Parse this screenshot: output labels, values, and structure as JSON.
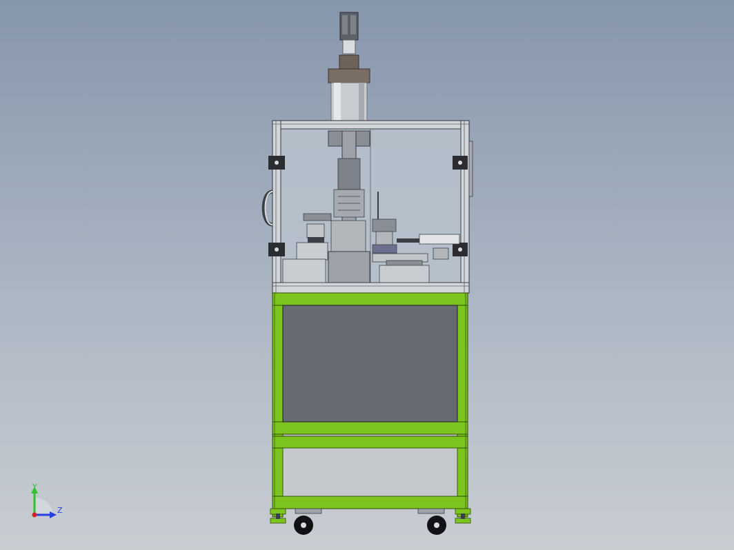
{
  "viewport": {
    "background_top": "#8696ab",
    "background_bottom": "#c9cdd2"
  },
  "model": {
    "frame_color": "#7cc41e",
    "frame_edge_color": "#2f4a0c",
    "panel_color": "#666a71",
    "glass_color": "#b9c2cc",
    "aluminum_color": "#d2d5d9"
  },
  "triad": {
    "y_label": "Y",
    "z_label": "Z",
    "y_color": "#2fc42f",
    "z_color": "#2a3fe0",
    "x_color": "#d4202a"
  }
}
